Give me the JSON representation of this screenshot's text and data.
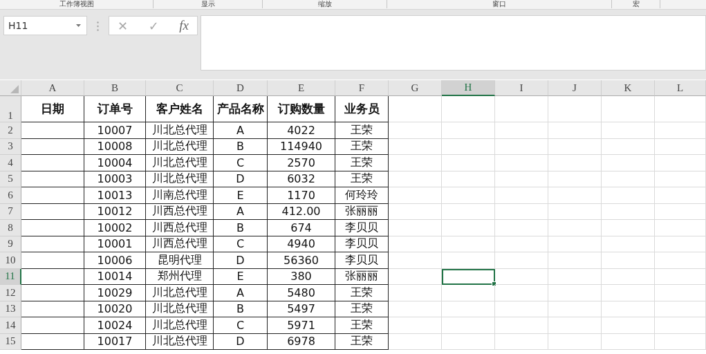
{
  "ribbon": {
    "groups": [
      "工作簿视图",
      "显示",
      "缩放",
      "窗口",
      "宏"
    ]
  },
  "formula_bar": {
    "name_box": "H11",
    "cancel": "✕",
    "enter": "✓",
    "function": "fx"
  },
  "sheet": {
    "columns": [
      {
        "label": "A",
        "selected": false
      },
      {
        "label": "B",
        "selected": false
      },
      {
        "label": "C",
        "selected": false
      },
      {
        "label": "D",
        "selected": false
      },
      {
        "label": "E",
        "selected": false
      },
      {
        "label": "F",
        "selected": false
      },
      {
        "label": "G",
        "selected": false
      },
      {
        "label": "H",
        "selected": true
      },
      {
        "label": "I",
        "selected": false
      },
      {
        "label": "J",
        "selected": false
      },
      {
        "label": "K",
        "selected": false
      },
      {
        "label": "L",
        "selected": false
      }
    ],
    "rows": [
      {
        "label": "1",
        "selected": false,
        "kind": "header",
        "cells": [
          "日期",
          "订单号",
          "客户姓名",
          "产品名称",
          "订购数量",
          "业务员"
        ]
      },
      {
        "label": "2",
        "selected": false,
        "kind": "data",
        "cells": [
          "",
          "10007",
          "川北总代理",
          "A",
          "4022",
          "王荣"
        ]
      },
      {
        "label": "3",
        "selected": false,
        "kind": "data",
        "cells": [
          "",
          "10008",
          "川北总代理",
          "B",
          "114940",
          "王荣"
        ]
      },
      {
        "label": "4",
        "selected": false,
        "kind": "data",
        "cells": [
          "",
          "10004",
          "川北总代理",
          "C",
          "2570",
          "王荣"
        ]
      },
      {
        "label": "5",
        "selected": false,
        "kind": "data",
        "cells": [
          "",
          "10003",
          "川北总代理",
          "D",
          "6032",
          "王荣"
        ]
      },
      {
        "label": "6",
        "selected": false,
        "kind": "data",
        "cells": [
          "",
          "10013",
          "川南总代理",
          "E",
          "1170",
          "何玲玲"
        ]
      },
      {
        "label": "7",
        "selected": false,
        "kind": "data",
        "cells": [
          "",
          "10012",
          "川西总代理",
          "A",
          "412.00",
          "张丽丽"
        ]
      },
      {
        "label": "8",
        "selected": false,
        "kind": "data",
        "cells": [
          "",
          "10002",
          "川西总代理",
          "B",
          "674",
          "李贝贝"
        ]
      },
      {
        "label": "9",
        "selected": false,
        "kind": "data",
        "cells": [
          "",
          "10001",
          "川西总代理",
          "C",
          "4940",
          "李贝贝"
        ]
      },
      {
        "label": "10",
        "selected": false,
        "kind": "data",
        "cells": [
          "",
          "10006",
          "昆明代理",
          "D",
          "56360",
          "李贝贝"
        ]
      },
      {
        "label": "11",
        "selected": true,
        "kind": "data",
        "cells": [
          "",
          "10014",
          "郑州代理",
          "E",
          "380",
          "张丽丽"
        ]
      },
      {
        "label": "12",
        "selected": false,
        "kind": "data",
        "cells": [
          "",
          "10029",
          "川北总代理",
          "A",
          "5480",
          "王荣"
        ]
      },
      {
        "label": "13",
        "selected": false,
        "kind": "data",
        "cells": [
          "",
          "10020",
          "川北总代理",
          "B",
          "5497",
          "王荣"
        ]
      },
      {
        "label": "14",
        "selected": false,
        "kind": "data",
        "cells": [
          "",
          "10024",
          "川北总代理",
          "C",
          "5971",
          "王荣"
        ]
      },
      {
        "label": "15",
        "selected": false,
        "kind": "data",
        "cells": [
          "",
          "10017",
          "川北总代理",
          "D",
          "6978",
          "王荣"
        ]
      }
    ]
  }
}
